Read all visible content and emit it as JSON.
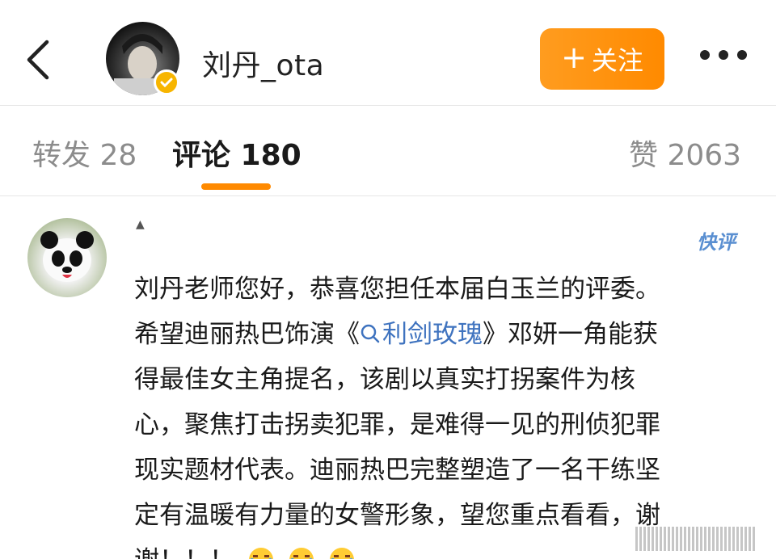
{
  "header": {
    "username": "刘丹_ota",
    "follow_label": "关注",
    "follow_plus": "+"
  },
  "tabs": [
    {
      "label": "转发 28"
    },
    {
      "label": "评论 180"
    },
    {
      "label": "赞 2063"
    }
  ],
  "comment": {
    "small_mark": "▲",
    "badge": "快评",
    "lines": [
      "刘丹老师您好，恭喜您担任本届白玉兰的评委。",
      "希望迪丽热巴饰演《",
      "》邓妍一角能获",
      "得最佳女主角提名，该剧以真实打拐案件为核",
      "心，聚焦打击拐卖犯罪，是难得一见的刑侦犯罪",
      "现实题材代表。迪丽热巴完整塑造了一名干练坚",
      "定有温暖有力量的女警形象，望您重点看看，谢",
      "谢！！！"
    ],
    "topic_link": "利剑玫瑰",
    "emoji_name": "crying-laugh-icon"
  },
  "colors": {
    "accent": "#ff8a00",
    "link": "#3f73bf",
    "verified": "#f7b500"
  }
}
